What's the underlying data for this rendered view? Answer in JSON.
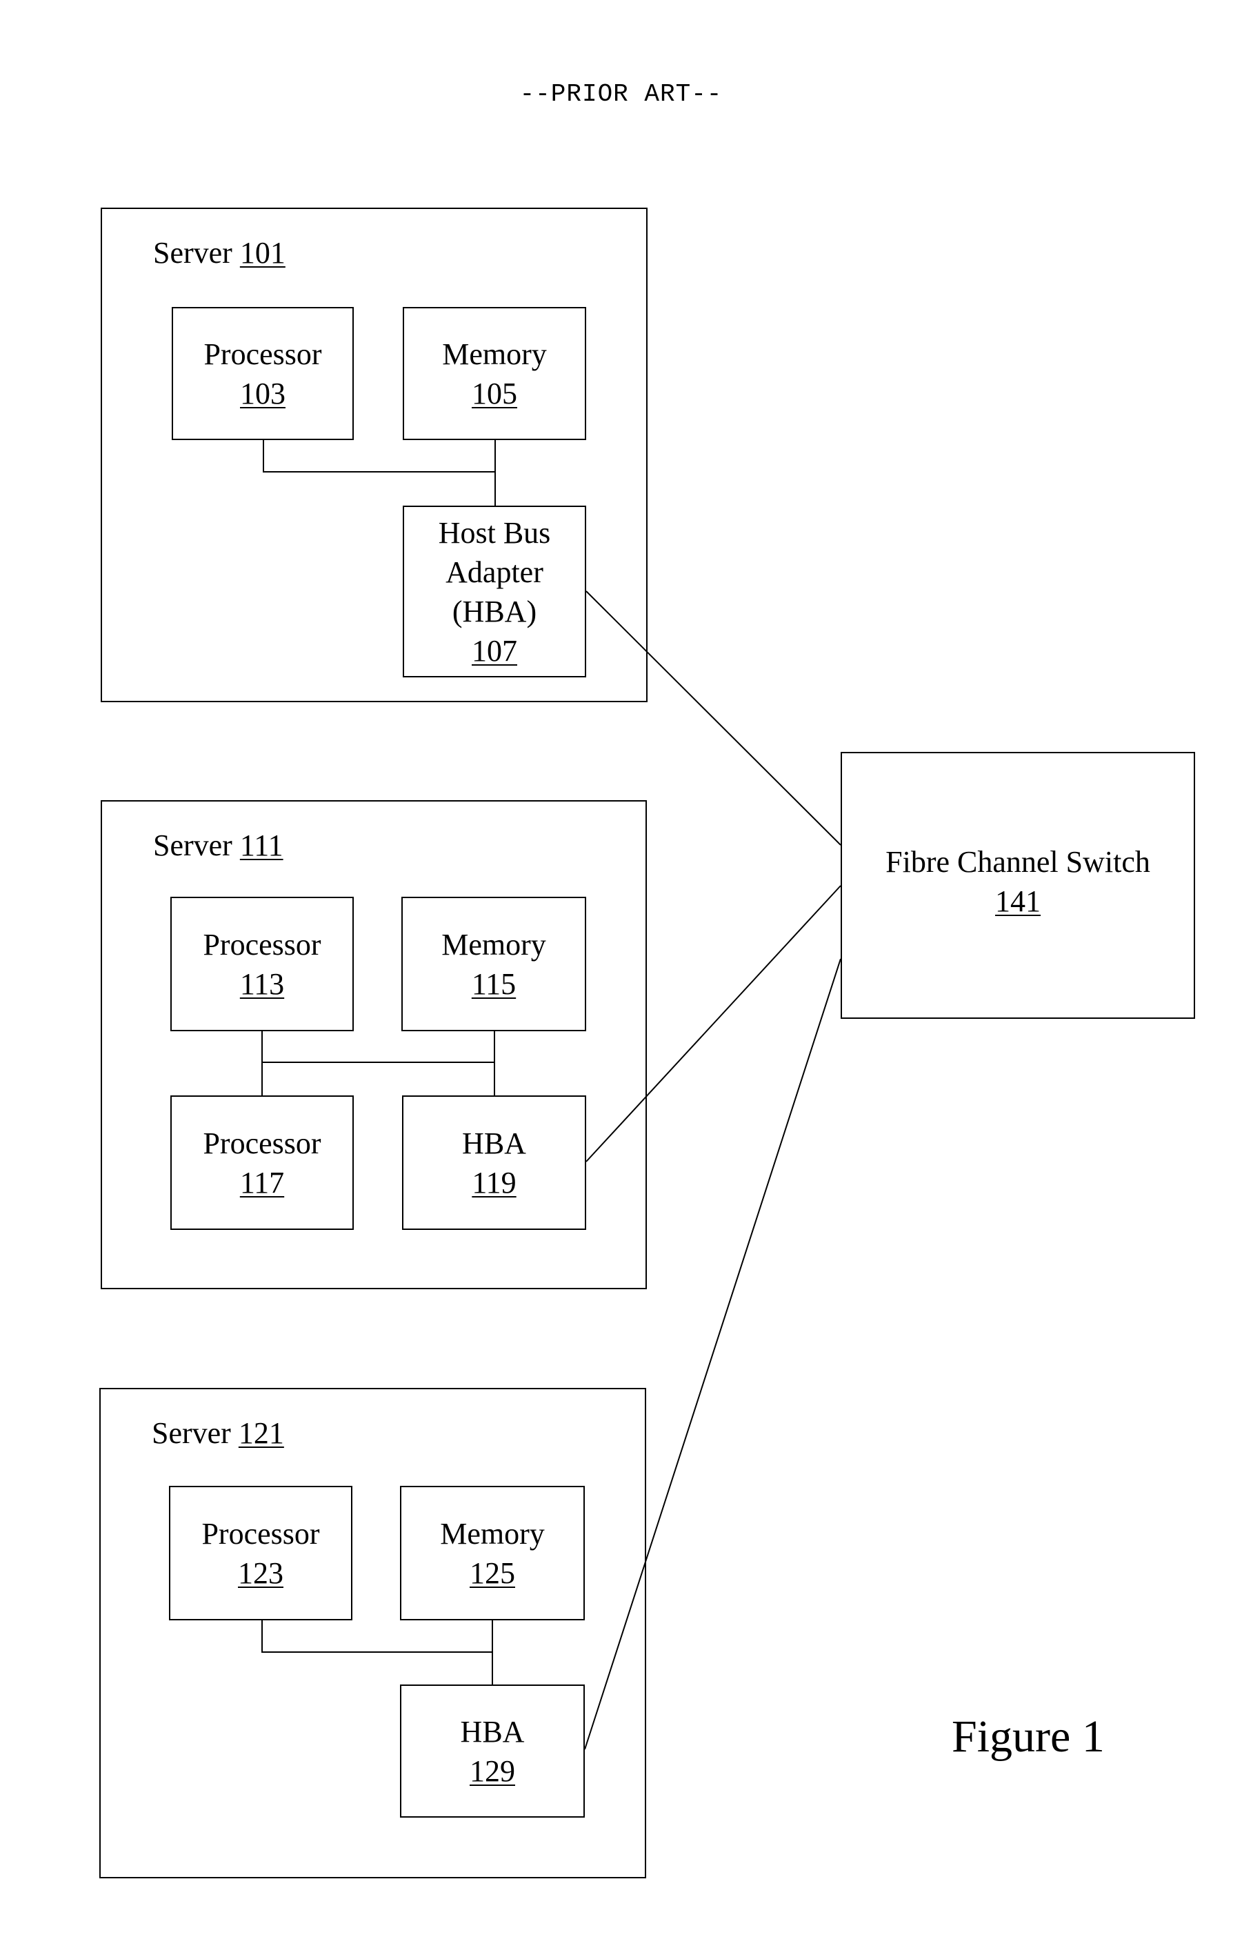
{
  "header": {
    "text": "--PRIOR ART--"
  },
  "servers": [
    {
      "label": "Server",
      "number": "101",
      "components": [
        {
          "lines": [
            "Processor"
          ],
          "number": "103"
        },
        {
          "lines": [
            "Memory"
          ],
          "number": "105"
        },
        {
          "lines": [
            "Host Bus",
            "Adapter",
            "(HBA)"
          ],
          "number": "107"
        }
      ]
    },
    {
      "label": "Server",
      "number": "111",
      "components": [
        {
          "lines": [
            "Processor"
          ],
          "number": "113"
        },
        {
          "lines": [
            "Memory"
          ],
          "number": "115"
        },
        {
          "lines": [
            "Processor"
          ],
          "number": "117"
        },
        {
          "lines": [
            "HBA"
          ],
          "number": "119"
        }
      ]
    },
    {
      "label": "Server",
      "number": "121",
      "components": [
        {
          "lines": [
            "Processor"
          ],
          "number": "123"
        },
        {
          "lines": [
            "Memory"
          ],
          "number": "125"
        },
        {
          "lines": [
            "HBA"
          ],
          "number": "129"
        }
      ]
    }
  ],
  "switch": {
    "label": "Fibre Channel Switch",
    "number": "141"
  },
  "figure": {
    "label": "Figure 1"
  },
  "connections": [
    {
      "from": "HBA 107",
      "to": "Fibre Channel Switch 141"
    },
    {
      "from": "HBA 119",
      "to": "Fibre Channel Switch 141"
    },
    {
      "from": "HBA 129",
      "to": "Fibre Channel Switch 141"
    }
  ]
}
